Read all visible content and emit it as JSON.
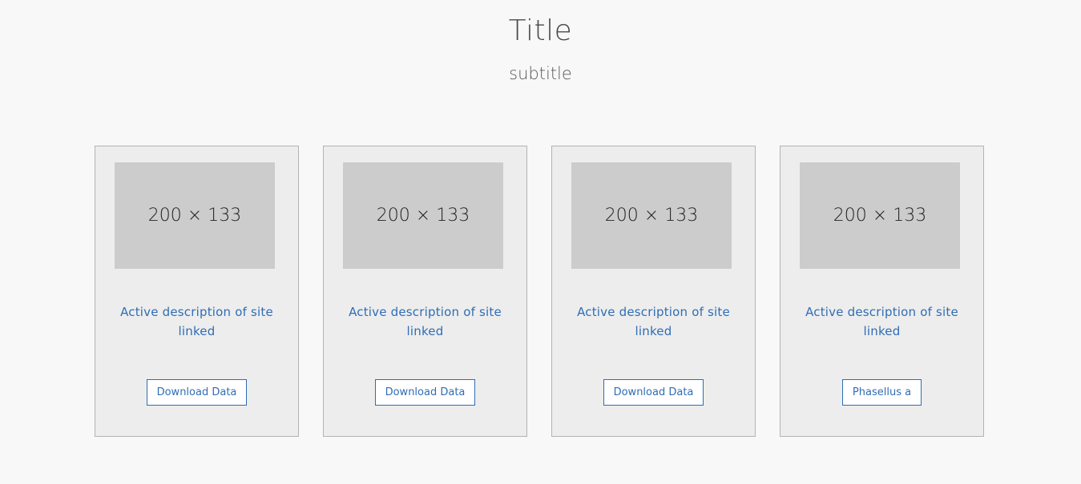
{
  "header": {
    "title": "Title",
    "subtitle": "subtitle"
  },
  "cards": [
    {
      "image_label": "200 × 133",
      "description": "Active description of site linked",
      "button_label": "Download Data"
    },
    {
      "image_label": "200 × 133",
      "description": "Active description of site linked",
      "button_label": "Download Data"
    },
    {
      "image_label": "200 × 133",
      "description": "Active description of site linked",
      "button_label": "Download Data"
    },
    {
      "image_label": "200 × 133",
      "description": "Active description of site linked",
      "button_label": "Phasellus a"
    }
  ],
  "colors": {
    "background": "#f8f8f8",
    "card_background": "#ededed",
    "card_border": "#b3b3b3",
    "placeholder": "#cccccc",
    "link": "#2f6db5"
  }
}
